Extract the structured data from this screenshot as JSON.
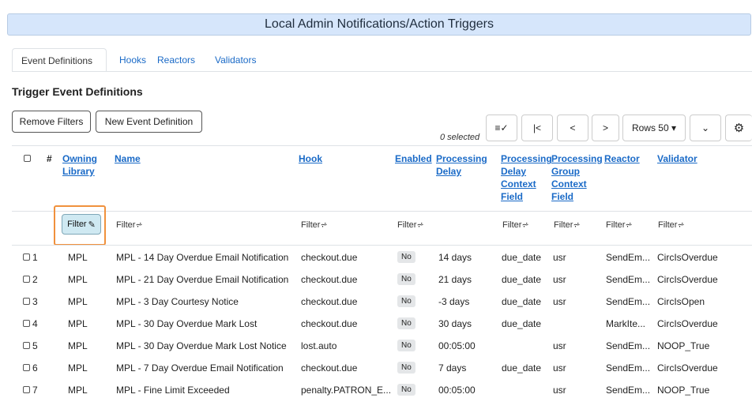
{
  "banner": {
    "title": "Local Admin Notifications/Action Triggers"
  },
  "tabs": [
    {
      "label": "Event Definitions"
    },
    {
      "label": "Hooks"
    },
    {
      "label": "Reactors"
    },
    {
      "label": "Validators"
    }
  ],
  "section": {
    "title": "Trigger Event Definitions"
  },
  "toolbar": {
    "remove_filters": "Remove Filters",
    "new_event": "New Event Definition",
    "selected_count": "0 selected",
    "rows_label": "Rows 50 ▾",
    "first_icon": "|<",
    "prev_icon": "<",
    "next_icon": ">",
    "chevron_icon": "⌄",
    "gear_icon": "⚙",
    "sort_icon": "≡✓"
  },
  "table": {
    "headers": {
      "hash": "#",
      "owning_library": [
        "Owning",
        "Library"
      ],
      "name": "Name",
      "hook": "Hook",
      "enabled": "Enabled",
      "proc_delay": [
        "Processing",
        "Delay"
      ],
      "proc_delay_ctx": [
        "Processing",
        "Delay",
        "Context",
        "Field"
      ],
      "proc_group_ctx": [
        "Processing",
        "Group",
        "Context",
        "Field"
      ],
      "reactor": "Reactor",
      "validator": "Validator"
    },
    "filter_label": "Filter",
    "filter_icon": "⩫",
    "active_filter_label": "Filter",
    "pencil_icon": "✎",
    "rows": [
      {
        "n": "1",
        "lib": "MPL",
        "name": "MPL - 14 Day Overdue Email Notification",
        "hook": "checkout.due",
        "enabled": "No",
        "delay": "14 days",
        "dctx": "due_date",
        "gctx": "usr",
        "reactor": "SendEm...",
        "validator": "CircIsOverdue"
      },
      {
        "n": "2",
        "lib": "MPL",
        "name": "MPL - 21 Day Overdue Email Notification",
        "hook": "checkout.due",
        "enabled": "No",
        "delay": "21 days",
        "dctx": "due_date",
        "gctx": "usr",
        "reactor": "SendEm...",
        "validator": "CircIsOverdue"
      },
      {
        "n": "3",
        "lib": "MPL",
        "name": "MPL - 3 Day Courtesy Notice",
        "hook": "checkout.due",
        "enabled": "No",
        "delay": "-3 days",
        "dctx": "due_date",
        "gctx": "usr",
        "reactor": "SendEm...",
        "validator": "CircIsOpen"
      },
      {
        "n": "4",
        "lib": "MPL",
        "name": "MPL - 30 Day Overdue Mark Lost",
        "hook": "checkout.due",
        "enabled": "No",
        "delay": "30 days",
        "dctx": "due_date",
        "gctx": "",
        "reactor": "MarkIte...",
        "validator": "CircIsOverdue"
      },
      {
        "n": "5",
        "lib": "MPL",
        "name": "MPL - 30 Day Overdue Mark Lost Notice",
        "hook": "lost.auto",
        "enabled": "No",
        "delay": "00:05:00",
        "dctx": "",
        "gctx": "usr",
        "reactor": "SendEm...",
        "validator": "NOOP_True"
      },
      {
        "n": "6",
        "lib": "MPL",
        "name": "MPL - 7 Day Overdue Email Notification",
        "hook": "checkout.due",
        "enabled": "No",
        "delay": "7 days",
        "dctx": "due_date",
        "gctx": "usr",
        "reactor": "SendEm...",
        "validator": "CircIsOverdue"
      },
      {
        "n": "7",
        "lib": "MPL",
        "name": "MPL - Fine Limit Exceeded",
        "hook": "penalty.PATRON_E...",
        "enabled": "No",
        "delay": "00:05:00",
        "dctx": "",
        "gctx": "usr",
        "reactor": "SendEm...",
        "validator": "NOOP_True"
      }
    ]
  }
}
